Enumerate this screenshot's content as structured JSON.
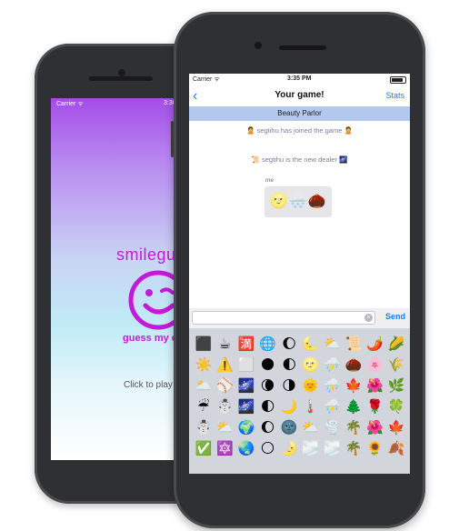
{
  "back_phone": {
    "status": {
      "carrier": "Carrier ᯤ",
      "time": "3:38 PM"
    },
    "logo_text": "smilegu",
    "tagline": "guess my e",
    "click_to_play": "Click to play"
  },
  "front_phone": {
    "status": {
      "carrier": "Carrier ᯤ",
      "time": "3:35 PM"
    },
    "nav": {
      "back_icon": "chevron-left-icon",
      "title": "Your game!",
      "stats_label": "Stats"
    },
    "room_banner": "Beauty Parlor",
    "messages": [
      {
        "text": "🙎 segtihu has joined the game 🙎"
      },
      {
        "text": "📜 segtihu is the new dealer 🌌"
      }
    ],
    "chat": {
      "sender": "me",
      "bubble": "🌝🌨️🌰"
    },
    "input": {
      "value": "",
      "placeholder": ""
    },
    "send_label": "Send",
    "emoji_keys": [
      "⬛",
      "☕",
      "🈵",
      "🌐",
      "🌔",
      "🌜",
      "⛅",
      "📜",
      "🌶️",
      "🌽",
      "☀️",
      "⚠️",
      "⬜",
      "🌑",
      "🌓",
      "🌝",
      "⛈️",
      "🌰",
      "🌸",
      "🌾",
      "🌥️",
      "⚾",
      "🌌",
      "🌘",
      "🌗",
      "🌞",
      "⛈️",
      "🍁",
      "🌺",
      "🌿",
      "☔",
      "☃️",
      "🌌",
      "🌓",
      "🌙",
      "🌡️",
      "⛈️",
      "🌲",
      "🌹",
      "🍀",
      "☃️",
      "⛅",
      "🌍",
      "🌔",
      "🌚",
      "⛅",
      "🌪️",
      "🌴",
      "🌺",
      "🍁",
      "✅",
      "🔯",
      "🌏",
      "🌕",
      "🌛",
      "🌫️",
      "🌫️",
      "🌴",
      "🌻",
      "🍂"
    ],
    "colors": {
      "accent": "#1a7bf0",
      "banner": "#b2c8ec",
      "brand": "#c21ad6"
    }
  }
}
